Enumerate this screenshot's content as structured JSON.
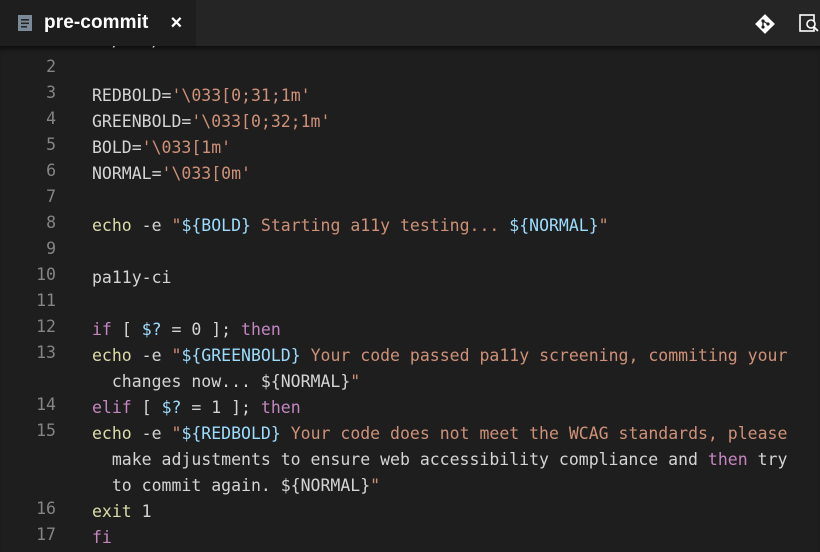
{
  "tab": {
    "title": "pre-commit",
    "close_glyph": "×"
  },
  "icons": {
    "file": "file-icon",
    "git": "git-icon",
    "preview": "open-preview-icon"
  },
  "editor": {
    "lines": [
      {
        "n": "2",
        "code": ""
      },
      {
        "n": "3",
        "code": "REDBOLD='\\033[0;31;1m'"
      },
      {
        "n": "4",
        "code": "GREENBOLD='\\033[0;32;1m'"
      },
      {
        "n": "5",
        "code": "BOLD='\\033[1m'"
      },
      {
        "n": "6",
        "code": "NORMAL='\\033[0m'"
      },
      {
        "n": "7",
        "code": ""
      },
      {
        "n": "8",
        "code": "echo -e \"${BOLD} Starting a11y testing... ${NORMAL}\""
      },
      {
        "n": "9",
        "code": ""
      },
      {
        "n": "10",
        "code": "pa11y-ci"
      },
      {
        "n": "11",
        "code": ""
      },
      {
        "n": "12",
        "code": "if [ $? = 0 ]; then"
      },
      {
        "n": "13",
        "code": "  echo -e \"${GREENBOLD} Your code passed pa11y screening, commiting your changes now... ${NORMAL}\""
      },
      {
        "n": "14",
        "code": "elif [ $? = 1 ]; then"
      },
      {
        "n": "15",
        "code": "  echo -e \"${REDBOLD} Your code does not meet the WCAG standards, please make adjustments to ensure web accessibility compliance and then try to commit again. ${NORMAL}\""
      },
      {
        "n": "16",
        "code": "  exit 1"
      },
      {
        "n": "17",
        "code": "fi"
      }
    ]
  },
  "colors": {
    "keyword": "#c586c0",
    "function": "#dcdcaa",
    "string": "#ce9178",
    "variable": "#9cdcfe",
    "line_number": "#858585",
    "background": "#1e1e1e"
  }
}
